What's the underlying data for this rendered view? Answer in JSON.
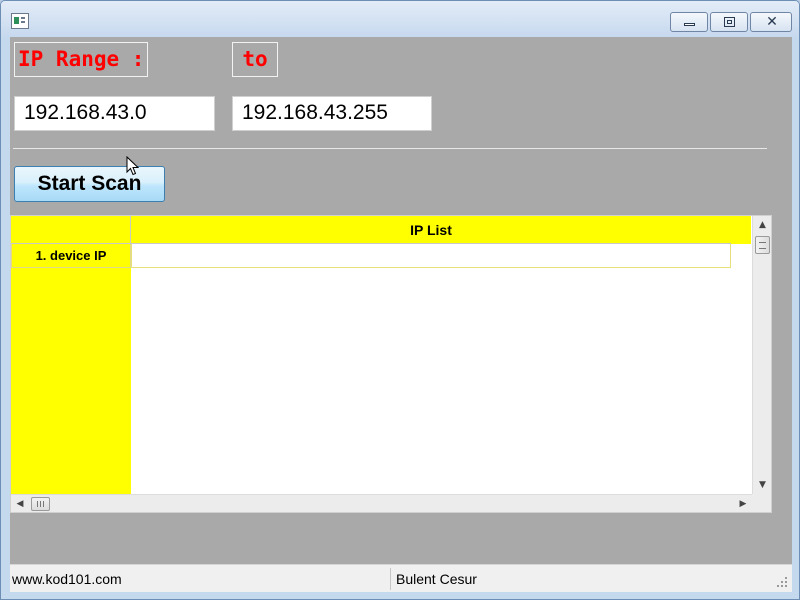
{
  "window": {
    "title": ""
  },
  "form": {
    "ip_range_label": "IP Range :",
    "to_label": "to",
    "from_ip": "192.168.43.0",
    "to_ip": "192.168.43.255",
    "start_button": "Start Scan"
  },
  "grid": {
    "column_header": "IP List",
    "rows": [
      {
        "header": "1. device IP",
        "value": ""
      }
    ]
  },
  "status": {
    "left": "www.kod101.com",
    "right": "Bulent Cesur"
  },
  "colors": {
    "label_red": "#ff0000",
    "grid_yellow": "#ffff00",
    "client_gray": "#a9a9a9"
  },
  "icons": [
    "app-icon",
    "minimize-icon",
    "maximize-icon",
    "close-icon",
    "mouse-cursor-icon",
    "scroll-up-icon",
    "scroll-down-icon",
    "scroll-left-icon",
    "scroll-right-icon",
    "resize-grip-icon"
  ]
}
